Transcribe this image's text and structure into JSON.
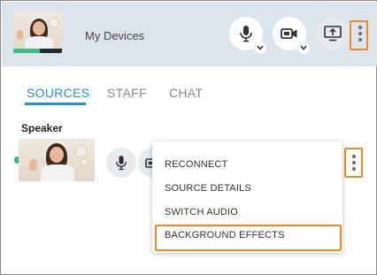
{
  "header": {
    "title": "My Devices",
    "mic_icon": "microphone-icon",
    "camera_icon": "video-camera-icon",
    "screen_icon": "screen-share-icon",
    "more_icon": "more-vertical-icon"
  },
  "tabs": [
    {
      "label": "SOURCES",
      "active": true
    },
    {
      "label": "STAFF",
      "active": false
    },
    {
      "label": "CHAT",
      "active": false
    }
  ],
  "sources": {
    "section_label": "Speaker",
    "status": "online",
    "mic_icon": "microphone-icon",
    "camera_icon": "video-camera-icon",
    "more_icon": "more-vertical-icon"
  },
  "menu": {
    "items": [
      {
        "label": "RECONNECT"
      },
      {
        "label": "SOURCE DETAILS"
      },
      {
        "label": "SWITCH AUDIO"
      },
      {
        "label": "BACKGROUND EFFECTS",
        "highlighted": true
      }
    ]
  },
  "colors": {
    "accent": "#2a8fc8",
    "highlight": "#f08a1c",
    "status_online": "#2fbf7a",
    "header_bg": "#dde5ec"
  }
}
